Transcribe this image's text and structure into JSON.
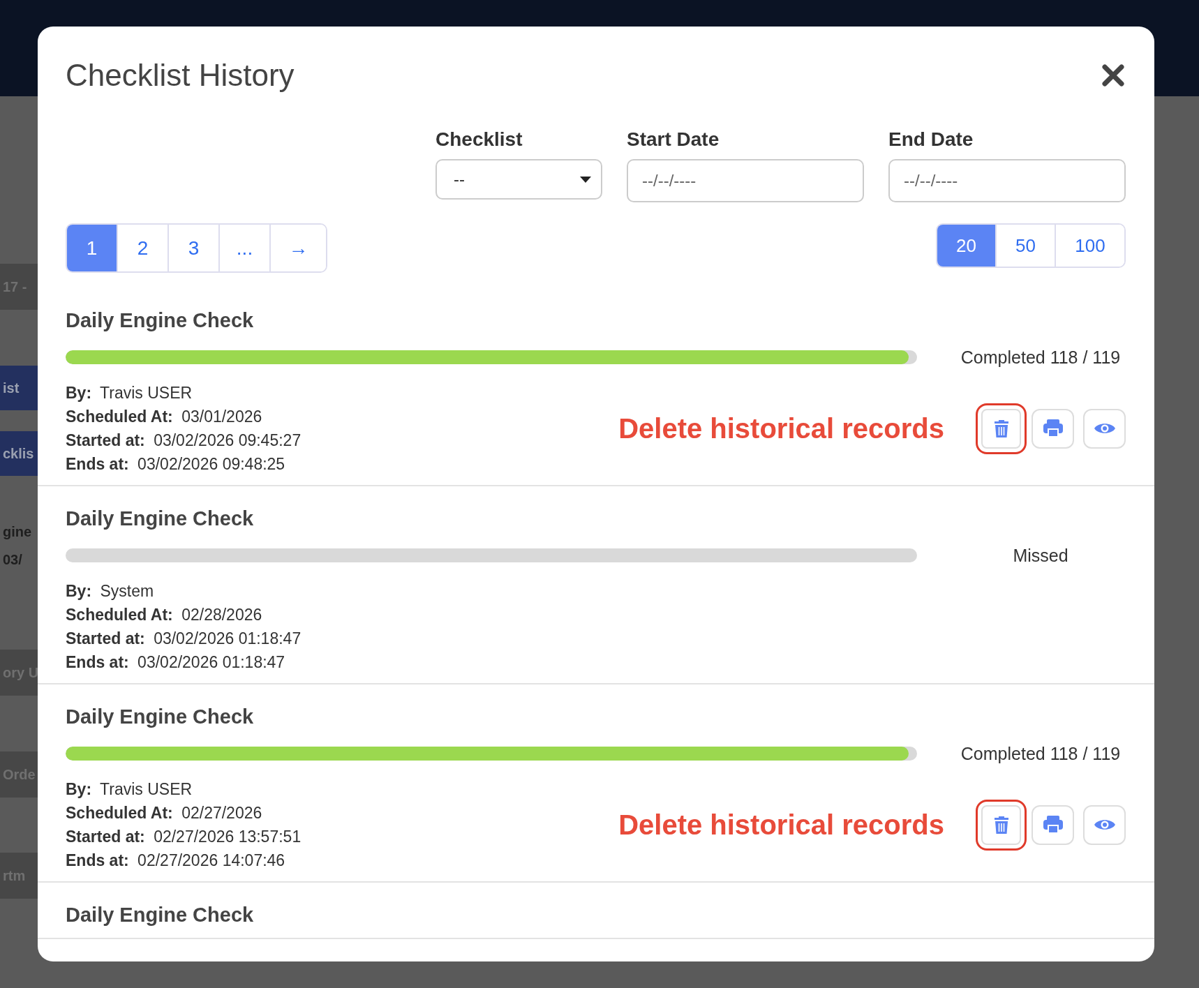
{
  "backdrop": [
    {
      "kind": "band",
      "text": "17 -"
    },
    {
      "kind": "highlight",
      "text": "ist"
    },
    {
      "kind": "highlight",
      "text": "cklis"
    },
    {
      "kind": "text",
      "text": "gine"
    },
    {
      "kind": "text",
      "text": "03/"
    },
    {
      "kind": "band",
      "text": "ory U"
    },
    {
      "kind": "band",
      "text": "Orde"
    },
    {
      "kind": "band",
      "text": "rtm"
    }
  ],
  "modal": {
    "title": "Checklist History",
    "filters": [
      {
        "kind": "select",
        "label": "Checklist",
        "value": "--"
      },
      {
        "kind": "date",
        "label": "Start Date",
        "placeholder": "--/--/----"
      },
      {
        "kind": "date",
        "label": "End Date",
        "placeholder": "--/--/----"
      }
    ],
    "pagination": [
      {
        "label": "1",
        "selected": true
      },
      {
        "label": "2",
        "selected": false
      },
      {
        "label": "3",
        "selected": false
      },
      {
        "label": "...",
        "selected": false
      },
      {
        "label": "→",
        "selected": false
      }
    ],
    "page_sizes": [
      {
        "label": "20",
        "selected": true
      },
      {
        "label": "50",
        "selected": false
      },
      {
        "label": "100",
        "selected": false
      }
    ],
    "records": [
      {
        "title": "Daily Engine Check",
        "kind": "completed",
        "status_text": "Completed 118 / 119",
        "level": 0.99,
        "fields": [
          {
            "label": "By:",
            "value": "Travis USER"
          },
          {
            "label": "Scheduled At:",
            "value": "03/01/2026"
          },
          {
            "label": "Started at:",
            "value": "03/02/2026 09:45:27"
          },
          {
            "label": "Ends at:",
            "value": "03/02/2026 09:48:25"
          }
        ],
        "annotation": "Delete historical records",
        "actions": [
          {
            "kind": "delete",
            "highlighted": true
          },
          {
            "kind": "print",
            "highlighted": false
          },
          {
            "kind": "view",
            "highlighted": false
          }
        ]
      },
      {
        "title": "Daily Engine Check",
        "kind": "missed",
        "status_text": "Missed",
        "level": 0,
        "fields": [
          {
            "label": "By:",
            "value": "System"
          },
          {
            "label": "Scheduled At:",
            "value": "02/28/2026"
          },
          {
            "label": "Started at:",
            "value": "03/02/2026 01:18:47"
          },
          {
            "label": "Ends at:",
            "value": "03/02/2026 01:18:47"
          }
        ]
      },
      {
        "title": "Daily Engine Check",
        "kind": "completed",
        "status_text": "Completed 118 / 119",
        "level": 0.99,
        "fields": [
          {
            "label": "By:",
            "value": "Travis USER"
          },
          {
            "label": "Scheduled At:",
            "value": "02/27/2026"
          },
          {
            "label": "Started at:",
            "value": "02/27/2026 13:57:51"
          },
          {
            "label": "Ends at:",
            "value": "02/27/2026 14:07:46"
          }
        ],
        "annotation": "Delete historical records",
        "actions": [
          {
            "kind": "delete",
            "highlighted": true
          },
          {
            "kind": "print",
            "highlighted": false
          },
          {
            "kind": "view",
            "highlighted": false
          }
        ]
      },
      {
        "title": "Daily Engine Check"
      }
    ]
  }
}
